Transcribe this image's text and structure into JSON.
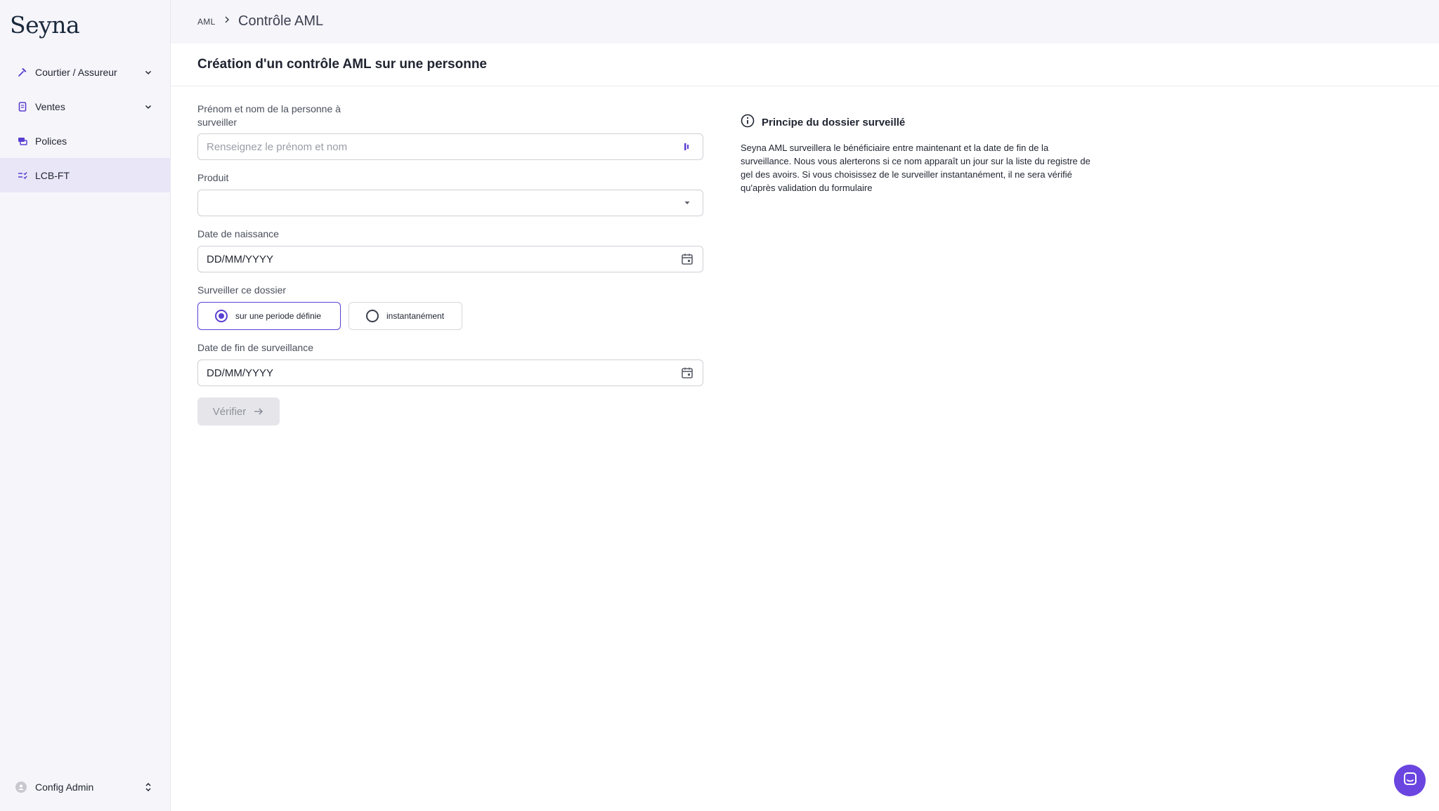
{
  "app": {
    "logo": "Seyna"
  },
  "sidebar": {
    "items": [
      {
        "label": "Courtier / Assureur",
        "icon": "hammer-icon",
        "has_chevron": true
      },
      {
        "label": "Ventes",
        "icon": "document-icon",
        "has_chevron": true
      },
      {
        "label": "Polices",
        "icon": "stack-icon",
        "has_chevron": false
      },
      {
        "label": "LCB-FT",
        "icon": "checklist-icon",
        "has_chevron": false,
        "active": true
      }
    ],
    "footer": {
      "label": "Config Admin",
      "icon": "user-circle-icon"
    }
  },
  "breadcrumb": {
    "parent": "AML",
    "current": "Contrôle AML"
  },
  "page": {
    "title": "Création d'un contrôle AML sur une personne"
  },
  "form": {
    "name_label": "Prénom et nom de la personne à surveiller",
    "name_placeholder": "Renseignez le prénom et nom",
    "name_value": "",
    "product_label": "Produit",
    "product_value": "",
    "birth_label": "Date de naissance",
    "birth_value": "DD/MM/YYYY",
    "monitor_label": "Surveiller ce dossier",
    "monitor_options": [
      {
        "label": "sur une periode définie",
        "selected": true
      },
      {
        "label": "instantanément",
        "selected": false
      }
    ],
    "end_label": "Date de fin de surveillance",
    "end_value": "DD/MM/YYYY",
    "submit_label": "Vérifier"
  },
  "info": {
    "title": "Principe du dossier surveillé",
    "text": "Seyna AML surveillera le bénéficiaire entre maintenant et la date de fin de la surveillance. Nous vous alerterons si ce nom apparaît un jour sur la liste du registre de gel des avoirs. Si vous choisissez de le surveiller instantanément, il ne sera vérifié qu'après validation du formulaire"
  },
  "colors": {
    "accent": "#5b3fd1",
    "sidebar_bg": "#f6f5fa",
    "active_bg": "#e9e6f7",
    "chat": "#6a45e0"
  }
}
